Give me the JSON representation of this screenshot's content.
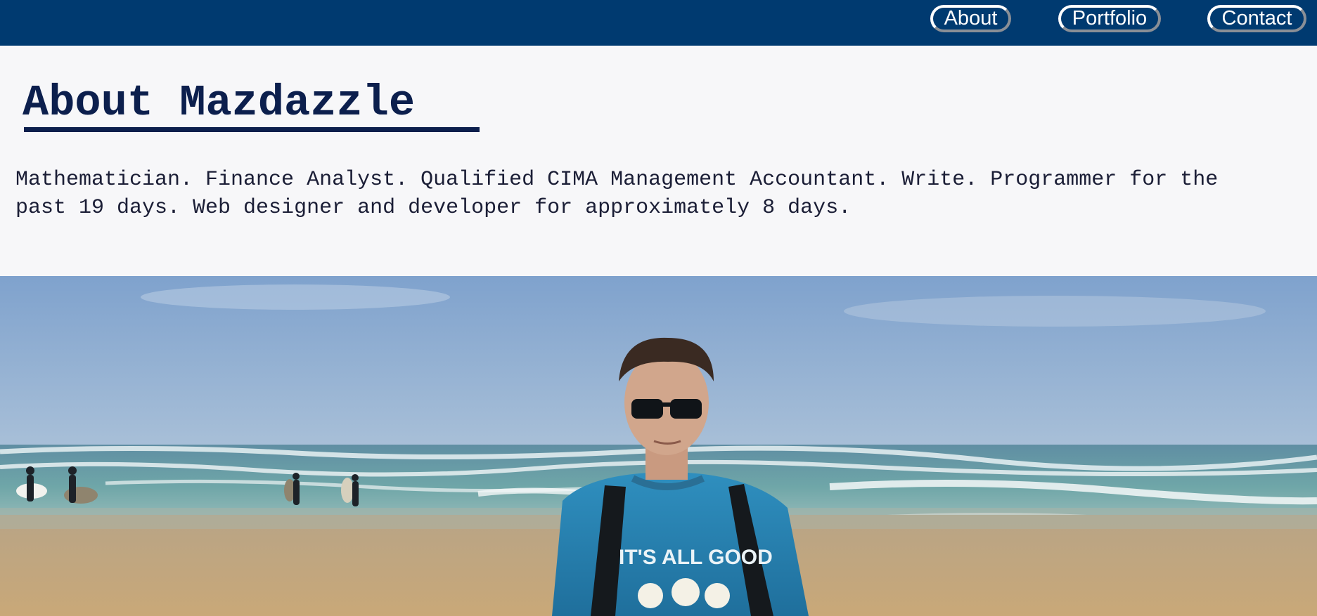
{
  "nav": {
    "items": [
      {
        "label": "About"
      },
      {
        "label": "Portfolio"
      },
      {
        "label": "Contact"
      }
    ]
  },
  "header": {
    "title": "About Mazdazzle",
    "bio": "Mathematician. Finance Analyst. Qualified CIMA Management Accountant. Write. Programmer for the past 19 days. Web designer and developer for approximately 8 days."
  },
  "hero": {
    "shirt_text": "IT'S ALL GOOD"
  },
  "colors": {
    "navbar": "#003a70",
    "page_background": "#f7f7f9",
    "title": "#0c1f4d",
    "nav_text": "#ffffff"
  }
}
